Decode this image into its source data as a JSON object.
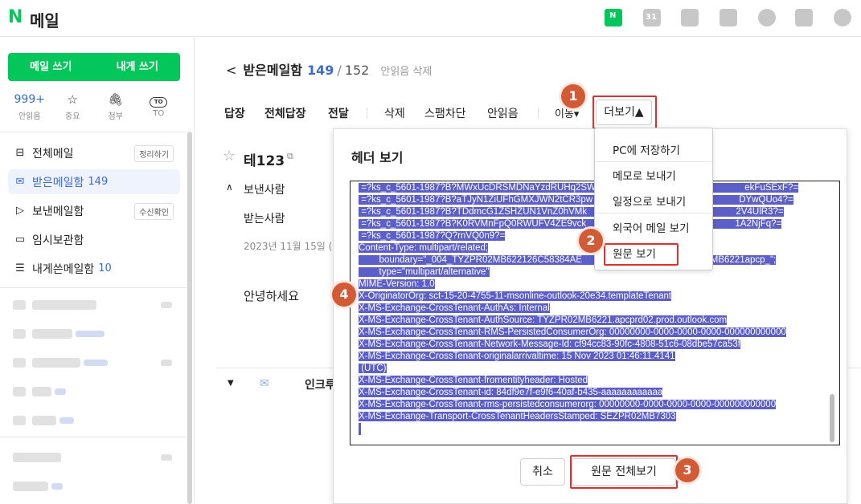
{
  "app": {
    "logo": "N",
    "title": "메일"
  },
  "topbar": {
    "mail_badge": "N",
    "calendar_num": "31"
  },
  "sidebar": {
    "write_label": "메일 쓰기",
    "self_write_label": "내게 쓰기",
    "quick": [
      {
        "value": "999+",
        "label": "안읽음"
      },
      {
        "icon": "star-icon",
        "label": "중요"
      },
      {
        "icon": "paperclip-icon",
        "label": "첨부"
      },
      {
        "icon": "to-icon",
        "label": "TO",
        "badge": "TO"
      }
    ],
    "folders": [
      {
        "label": "전체메일",
        "tag": "정리하기"
      },
      {
        "label": "받은메일함",
        "count": "149"
      },
      {
        "label": "보낸메일함",
        "tag": "수신확인"
      },
      {
        "label": "임시보관함"
      },
      {
        "label": "내게쓴메일함",
        "count": "10"
      }
    ]
  },
  "main": {
    "back": "<",
    "folder_title": "받은메일함",
    "unread_count": "149",
    "sep": "/",
    "total_count": "152",
    "delete_unread": "안읽음 삭제",
    "toolbar": [
      "답장",
      "전체답장",
      "전달",
      "삭제",
      "스팸차단",
      "안읽음",
      "이동▾"
    ],
    "more_label": "더보기▲",
    "subject": "테123",
    "sender_label": "보낸사람",
    "recipient_label": "받는사람",
    "date": "2023년 11월 15일 (",
    "body": "안녕하세요",
    "bottom_label": "인크루"
  },
  "dropdown": {
    "items": [
      "PC에 저장하기",
      "메모로 보내기",
      "일정으로 보내기",
      "외국어 메일 보기",
      "원문 보기"
    ]
  },
  "dialog": {
    "title": "헤더 보기",
    "lines": [
      " =?ks_c_5601-1987?B?MWxUcDRSMDNaYzdRUHq2SW                                                          ekFuSExF?=",
      " =?ks_c_5601-1987?B?aTJyN1ZiUFhGMXJWN2tCR3pw                                                         DYwQUo4?=",
      " =?ks_c_5601-1987?B?TDdmcG1ZSHZUN1VnZ0hVMk                                                          2V4UlR3?=",
      " =?ks_c_5601-1987?B?K0RVMnFpQ0RWUFV4ZE9vck                                                          1A2NjFq?=",
      " =?ks_c_5601-1987?Q?rnVQ0n9?=",
      "Content-Type: multipart/related;",
      "        boundary=\"_004_TYZPR02MB622126C58384AE                                                  MB6221apcp_\";",
      "        type=\"multipart/alternative\"",
      "MIME-Version: 1.0",
      "X-OriginatorOrg: sct-15-20-4755-11-msonline-outlook-20e34.templateTenant",
      "X-MS-Exchange-CrossTenant-AuthAs: Internal",
      "X-MS-Exchange-CrossTenant-AuthSource: TYZPR02MB6221.apcprd02.prod.outlook.com",
      "X-MS-Exchange-CrossTenant-RMS-PersistedConsumerOrg: 00000000-0000-0000-0000-000000000000",
      "X-MS-Exchange-CrossTenant-Network-Message-Id: cf94cc83-90fc-4808-51c6-08dbe57ca53f",
      "X-MS-Exchange-CrossTenant-originalarrivaltime: 15 Nov 2023 01:46:11.4141",
      " (UTC)",
      "X-MS-Exchange-CrossTenant-fromentityheader: Hosted",
      "X-MS-Exchange-CrossTenant-id: 84df9e7f-e9f6-40af-b435-aaaaaaaaaaaa",
      "X-MS-Exchange-CrossTenant-rms-persistedconsumerorg: 00000000-0000-0000-0000-000000000000",
      "X-MS-Exchange-Transport-CrossTenantHeadersStamped: SEZPR02MB7303",
      ""
    ],
    "cancel_label": "취소",
    "view_full_label": "원문 전체보기"
  },
  "badges": [
    "1",
    "2",
    "3",
    "4"
  ]
}
